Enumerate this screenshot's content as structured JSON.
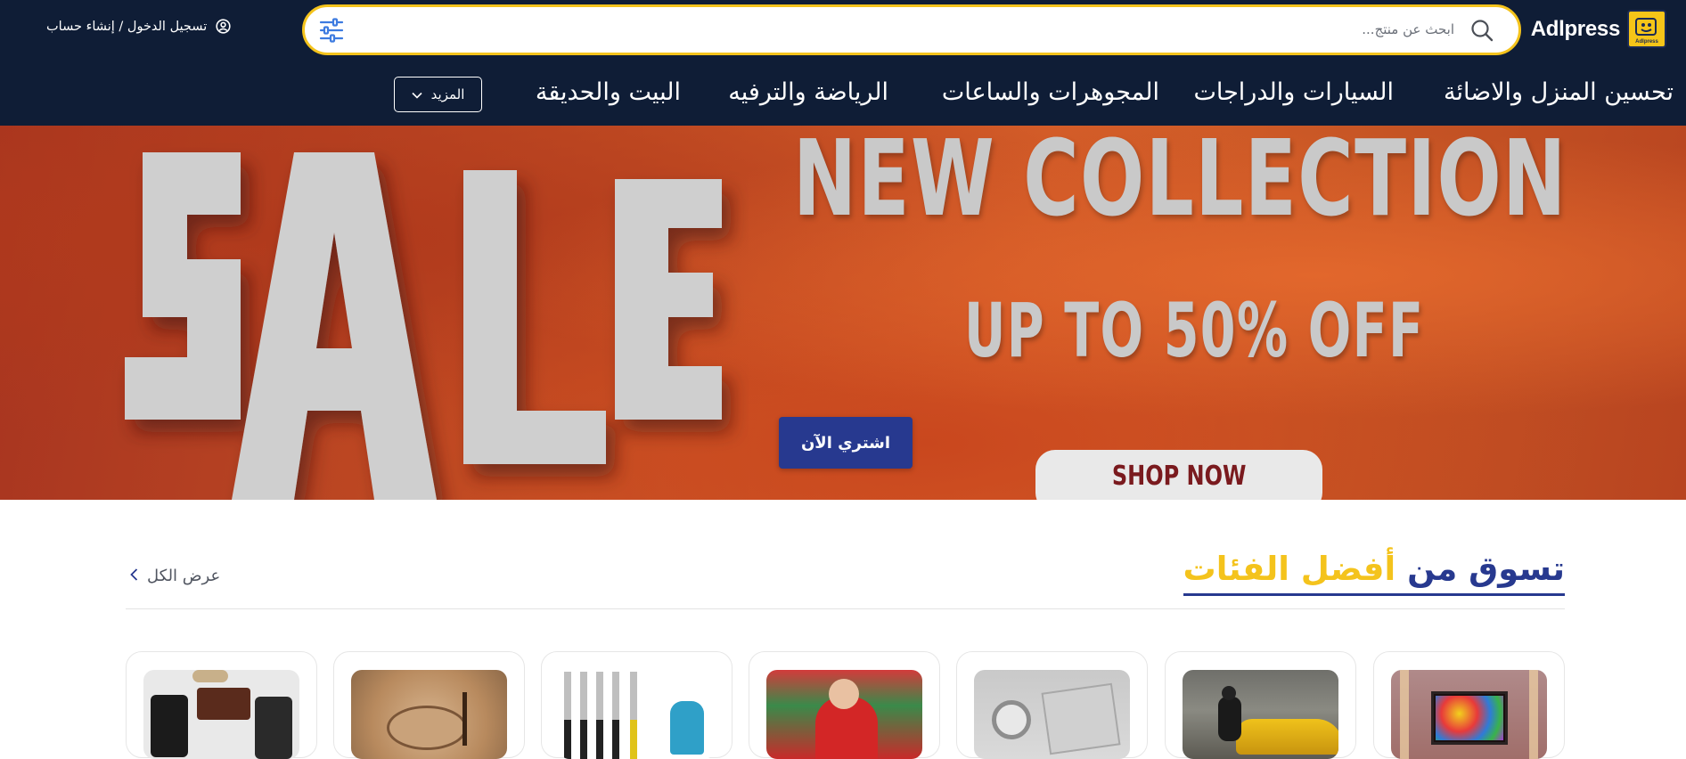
{
  "header": {
    "logo_text": "Adlpress",
    "logo_badge_text": "Adlpress",
    "search_placeholder": "ابحث عن منتج...",
    "auth_text": "تسجيل الدخول / إنشاء حساب"
  },
  "nav": {
    "items": [
      {
        "label": "تحسين المنزل والاضائة"
      },
      {
        "label": "السيارات والدراجات"
      },
      {
        "label": "المجوهرات والساعات"
      },
      {
        "label": "الرياضة والترفيه"
      },
      {
        "label": "البيت والحديقة"
      }
    ],
    "more_label": "المزيد"
  },
  "hero": {
    "title": "NEW COLLECTION",
    "subtitle": "UP TO 50% OFF",
    "shop_now": "SHOP NOW",
    "sale_word": "SALE",
    "buy_button": "اشتري الآن",
    "slides_count": 3,
    "active_slide": 2
  },
  "categories": {
    "title_part1": "تسوق من",
    "title_part2": "أفضل الفئات",
    "view_all": "عرض الكل",
    "cards": [
      {
        "name": "lighting"
      },
      {
        "name": "cars"
      },
      {
        "name": "watches"
      },
      {
        "name": "sports"
      },
      {
        "name": "garden-tools"
      },
      {
        "name": "crafts"
      },
      {
        "name": "accessories"
      }
    ]
  },
  "colors": {
    "header_bg": "#0f1d36",
    "accent_yellow": "#f4c31c",
    "primary_blue": "#27398f"
  }
}
